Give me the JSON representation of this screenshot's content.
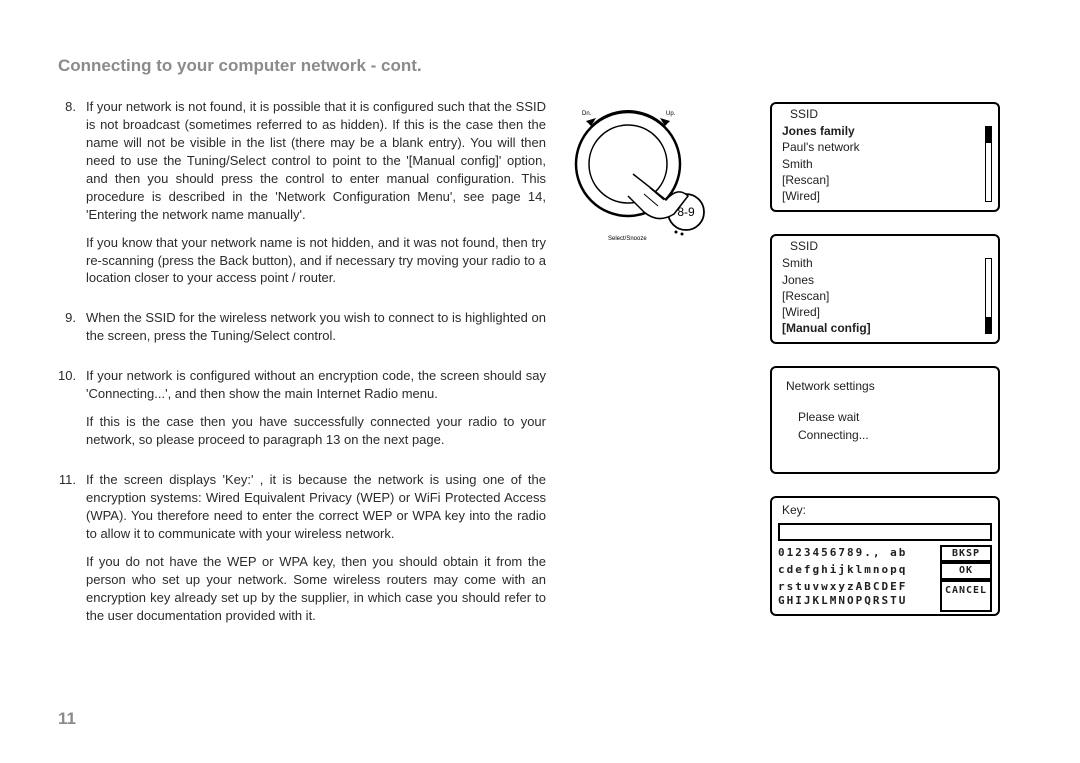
{
  "title": "Connecting to your computer network - cont.",
  "page_number": "11",
  "items": [
    {
      "num": "8.",
      "text": "If your network is not found, it is possible that it is conﬁgured such that the SSID is not broadcast (sometimes referred to as hidden). If this is the case then the name will not be visible in the list (there may be a blank entry). You will then need to use the Tuning/Select control to point to the '[Manual conﬁg]' option, and then you should press the control to enter manual conﬁguration. This procedure is described in the 'Network Conﬁguration Menu', see page 14, 'Entering the network name manually'.",
      "sub": "If you know that your network name is not hidden, and it was not found, then try re-scanning (press the Back button), and if necessary try moving your radio to a location closer to your access point / router."
    },
    {
      "num": "9.",
      "text": "When the SSID for the wireless network you wish to connect to is highlighted on the screen, press the Tuning/Select control."
    },
    {
      "num": "10.",
      "text": "If your network is conﬁgured without an encryption code, the screen should say 'Connecting...', and then show the main Internet Radio menu.",
      "sub": "If this is the case then you have successfully connected your radio to your network, so please proceed to paragraph 13 on the next page."
    },
    {
      "num": "11.",
      "text": "If the screen displays 'Key:' , it is because the network is using one of the encryption systems: Wired Equivalent Privacy (WEP) or WiFi Protected Access (WPA). You therefore need to enter the correct WEP or WPA key into the radio to allow it to communicate with your wireless network.",
      "sub": "If you do not have the WEP or WPA key, then you should obtain it from the person who set up your network. Some wireless routers may come with an encryption key already set up by the supplier, in which case you should refer to the user documentation provided with it."
    }
  ],
  "dial": {
    "dn": "Dn.",
    "up": "Up.",
    "badge": "8-9",
    "bottom": "Select/Snooze"
  },
  "screens": {
    "ssid1": {
      "header": "SSID",
      "items": [
        "Jones family",
        "Paul's network",
        "Smith",
        "[Rescan]",
        "[Wired]"
      ],
      "selected_index": 0
    },
    "ssid2": {
      "header": "SSID",
      "items": [
        "Smith",
        "Jones",
        "[Rescan]",
        "[Wired]",
        "[Manual config]"
      ],
      "selected_index": 4
    },
    "connecting": {
      "header": "Network settings",
      "line1": "Please wait",
      "line2": "Connecting..."
    },
    "key": {
      "header": "Key:",
      "row1": "0123456789., ab",
      "row2": "cdefghijklmnopq",
      "row3": "rstuvwxyzABCDEF",
      "row4": "GHIJKLMNOPQRSTU",
      "btn1": "BKSP",
      "btn2": "OK",
      "btn3": "CANCEL"
    }
  }
}
